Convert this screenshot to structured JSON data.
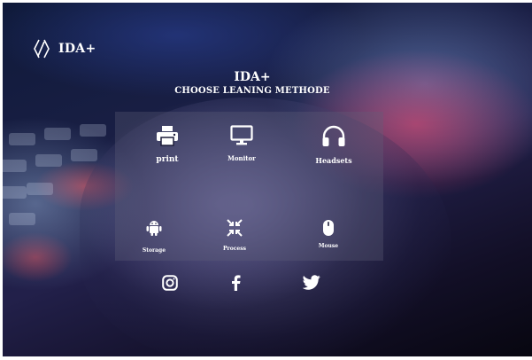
{
  "brand": {
    "name": "IDA+",
    "logo_icon": "diamond-chain-icon"
  },
  "heading": {
    "title": "IDA+",
    "subtitle": "CHOOSE LEANING METHODE"
  },
  "options": [
    {
      "label": "print",
      "icon": "printer-icon"
    },
    {
      "label": "Monitor",
      "icon": "monitor-icon"
    },
    {
      "label": "Headsets",
      "icon": "headphones-icon"
    },
    {
      "label": "Storage",
      "icon": "android-icon"
    },
    {
      "label": "Process",
      "icon": "compress-arrows-icon"
    },
    {
      "label": "Mouse",
      "icon": "mouse-icon"
    }
  ],
  "social": [
    {
      "icon": "instagram-icon"
    },
    {
      "icon": "facebook-icon"
    },
    {
      "icon": "twitter-icon"
    }
  ],
  "colors": {
    "text": "#ffffff",
    "panel": "rgba(95,95,120,0.32)"
  }
}
